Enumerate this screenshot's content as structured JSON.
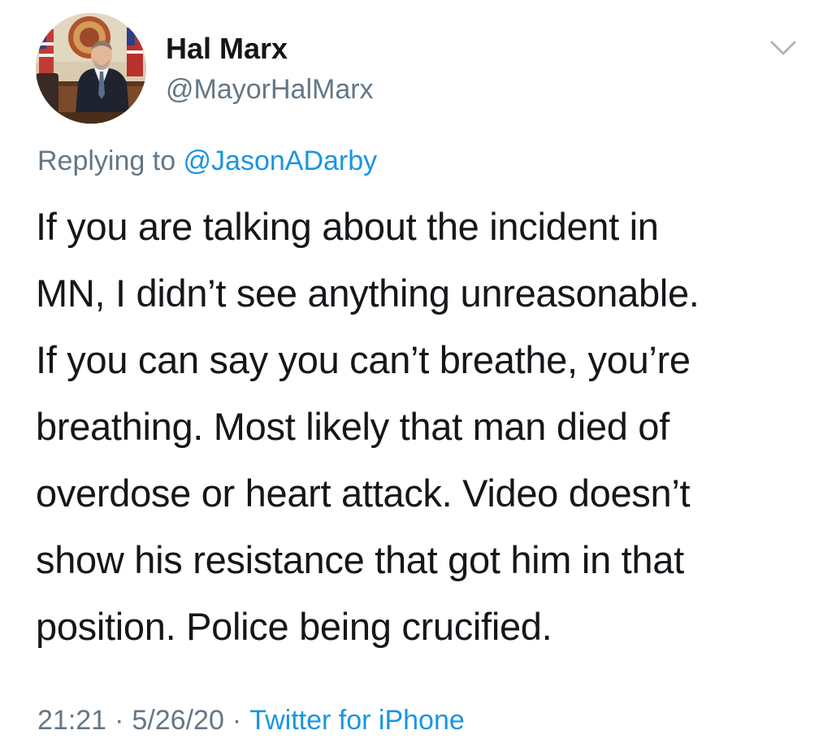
{
  "tweet": {
    "author_name": "Hal Marx",
    "author_handle": "@MayorHalMarx",
    "reply_prefix": "Replying to",
    "reply_mention": "@JasonADarby",
    "text_lines": [
      "If you are talking about the incident in",
      "MN, I didn’t see anything unreasonable.",
      "If you can say you can’t breathe, you’re",
      "breathing. Most likely that man died of",
      "overdose or heart attack. Video doesn’t",
      "show his resistance that got him in that",
      "position. Police being crucified."
    ],
    "time": "21:21",
    "date": "5/26/20",
    "separator": "·",
    "source": "Twitter for iPhone"
  },
  "icons": {
    "menu_caret": "chevron-down-icon",
    "avatar": "profile-photo"
  },
  "colors": {
    "text_primary": "#14171a",
    "text_secondary": "#657786",
    "link": "#1b95e0",
    "caret": "#aab8c2"
  }
}
